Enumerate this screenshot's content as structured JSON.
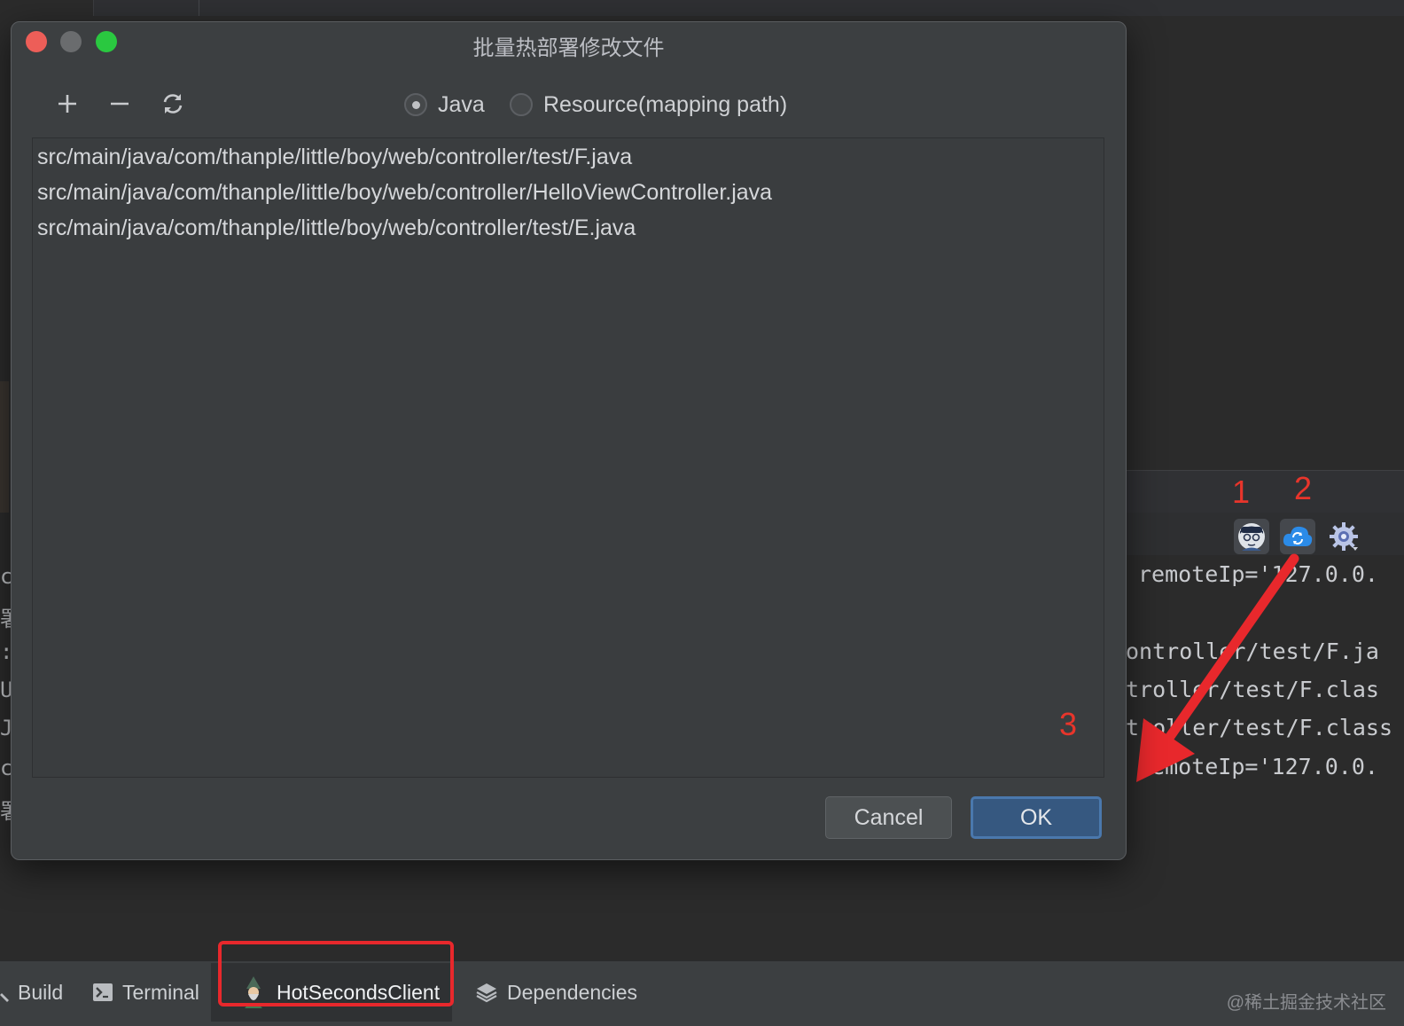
{
  "dialog": {
    "title": "批量热部署修改文件",
    "toolbar": {
      "add_icon": "plus-icon",
      "remove_icon": "minus-icon",
      "refresh_icon": "refresh-icon"
    },
    "radio_java_label": "Java",
    "radio_resource_label": "Resource(mapping path)",
    "selected_radio": "Java",
    "files": [
      "src/main/java/com/thanple/little/boy/web/controller/test/F.java",
      "src/main/java/com/thanple/little/boy/web/controller/HelloViewController.java",
      "src/main/java/com/thanple/little/boy/web/controller/test/E.java"
    ],
    "cancel_label": "Cancel",
    "ok_label": "OK"
  },
  "console": {
    "lines": [
      "remoteIp='127.0.0.",
      "ontroller/test/F.ja",
      "troller/test/F.clas",
      "troller/test/F.class",
      "remoteIp='127.0.0."
    ],
    "left_chars": [
      "c",
      "署",
      ":",
      "U",
      "J",
      "c",
      "署"
    ]
  },
  "console_toolbar": {
    "icons": [
      "user-avatar-icon",
      "hot-deploy-icon",
      "settings-gear-icon"
    ]
  },
  "annotations": {
    "one": "1",
    "two": "2",
    "three": "3"
  },
  "bottom_tabs": [
    {
      "label": "Build",
      "icon": "hammer-icon"
    },
    {
      "label": "Terminal",
      "icon": "terminal-icon"
    },
    {
      "label": "HotSecondsClient",
      "icon": "wizard-icon"
    },
    {
      "label": "Dependencies",
      "icon": "layers-icon"
    }
  ],
  "watermark": "@稀土掘金技术社区",
  "colors": {
    "close": "#ed5e58",
    "minimize": "#6a6c6e",
    "maximize": "#2ac840",
    "annotation": "#e8352b",
    "ok_button": "#365880"
  }
}
